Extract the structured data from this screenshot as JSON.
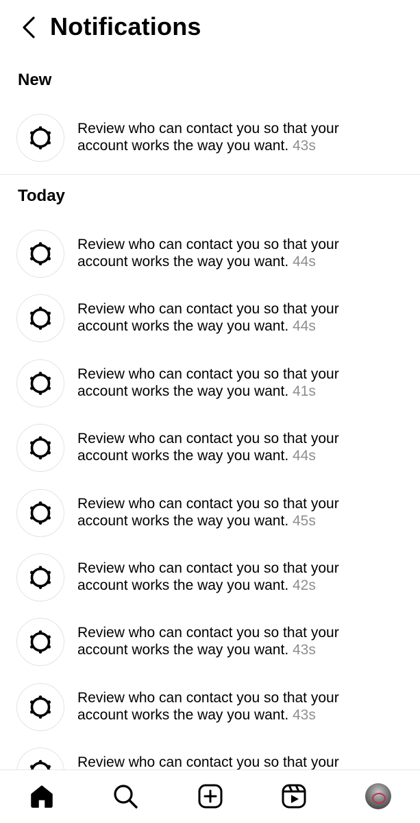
{
  "header": {
    "title": "Notifications",
    "back_icon": "chevron-left-icon"
  },
  "sections": {
    "new": {
      "title": "New",
      "items": [
        {
          "line1": "Review who can contact you so that your",
          "line2": "account works the way you want.",
          "time": "43s"
        }
      ]
    },
    "today": {
      "title": "Today",
      "items": [
        {
          "line1": "Review who can contact you so that your",
          "line2": "account works the way you want.",
          "time": "44s"
        },
        {
          "line1": "Review who can contact you so that your",
          "line2": "account works the way you want.",
          "time": "44s"
        },
        {
          "line1": "Review who can contact you so that your",
          "line2": "account works the way you want.",
          "time": "41s"
        },
        {
          "line1": "Review who can contact you so that your",
          "line2": "account works the way you want.",
          "time": "44s"
        },
        {
          "line1": "Review who can contact you so that your",
          "line2": "account works the way you want.",
          "time": "45s"
        },
        {
          "line1": "Review who can contact you so that your",
          "line2": "account works the way you want.",
          "time": "42s"
        },
        {
          "line1": "Review who can contact you so that your",
          "line2": "account works the way you want.",
          "time": "43s"
        },
        {
          "line1": "Review who can contact you so that your",
          "line2": "account works the way you want.",
          "time": "43s"
        },
        {
          "line1": "Review who can contact you so that your",
          "line2": "",
          "time": ""
        }
      ]
    }
  },
  "notification_icon": "gear-icon",
  "bottom_nav": {
    "items": [
      "home-icon",
      "search-icon",
      "create-icon",
      "reels-icon",
      "profile-avatar"
    ]
  },
  "colors": {
    "text": "#000000",
    "timestamp": "#8e8e8e",
    "divider": "#e6e6e6"
  }
}
